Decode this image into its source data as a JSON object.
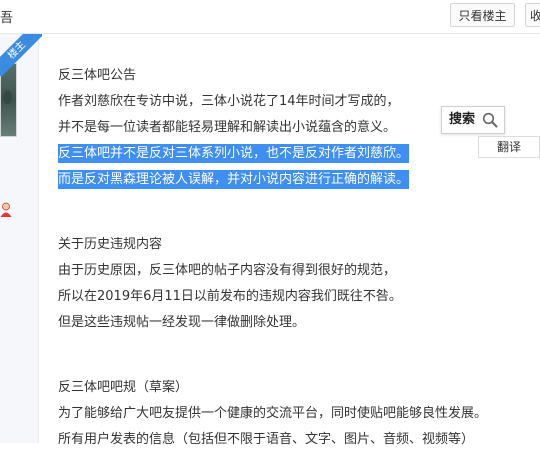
{
  "topbar": {
    "partial_left_text": "吾",
    "only_author_label": "只看楼主",
    "collect_partial_label": "收"
  },
  "badge": {
    "label": "楼主"
  },
  "post1": {
    "title": "反三体吧公告",
    "lines": [
      "作者刘慈欣在专访中说，三体小说花了14年时间才写成的，",
      "并不是每一位读者都能轻易理解和解读出小说蕴含的意义。",
      "反三体吧并不是反对三体系列小说，也不是反对作者刘慈欣。",
      "而是反对黑森理论被人误解，并对小说内容进行正确的解读。"
    ]
  },
  "post2": {
    "title": "关于历史违规内容",
    "lines": [
      "由于历史原因，反三体吧的帖子内容没有得到很好的规范，",
      "所以在2019年6月11日以前发布的违规内容我们既往不咎。",
      "但是这些违规帖一经发现一律做删除处理。"
    ]
  },
  "post3": {
    "title": "反三体吧吧规（草案）",
    "lines": [
      "为了能够给广大吧友提供一个健康的交流平台，同时使贴吧能够良性发展。",
      "所有用户发表的信息（包括但不限于语音、文字、图片、音频、视频等）"
    ]
  },
  "popup": {
    "search_label": "搜索",
    "translate_label": "翻译"
  },
  "colors": {
    "selection": "#3e8ff1",
    "badge": "#3b8ce0",
    "side_panel": "#f6f7fb"
  }
}
